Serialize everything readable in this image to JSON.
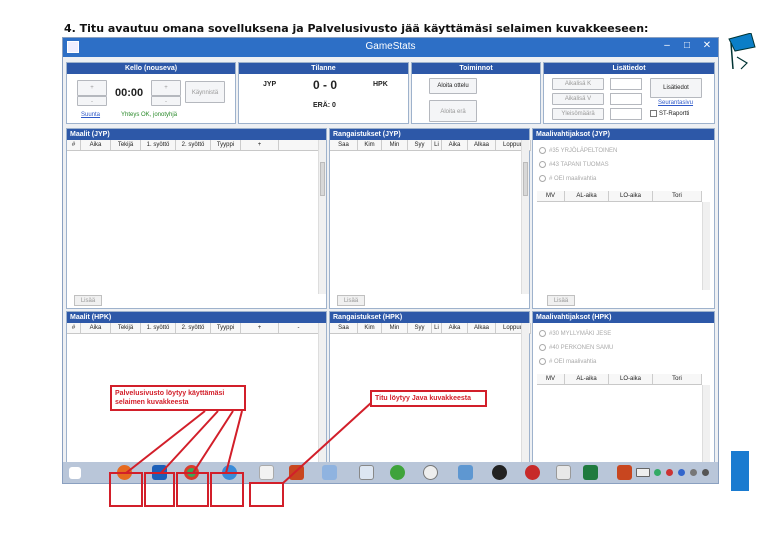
{
  "heading": "4. Titu avautuu omana sovelluksena ja Palvelusivusto jää käyttämäsi selaimen kuvakkeeseen:",
  "window": {
    "title": "GameStats",
    "controls": [
      "–",
      "□",
      "✕"
    ]
  },
  "clock_panel": {
    "header": "Kello (nouseva)",
    "plus": "+",
    "minus": "-",
    "time": "00:00",
    "start_button": "Käynnistä",
    "link": "Suunta",
    "status": "Yhteys OK, jonotyhjä"
  },
  "score_panel": {
    "header": "Tilanne",
    "home": "JYP",
    "away": "HPK",
    "score": "0 - 0",
    "period": "ERÄ: 0"
  },
  "actions_panel": {
    "header": "Toiminnot",
    "start_game": "Aloita ottelu",
    "start_period": "Aloita erä"
  },
  "extras_panel": {
    "header": "Lisätiedot",
    "labels": [
      "Aikalisä K",
      "Aikalisä V",
      "Yleisömäärä"
    ],
    "add_button": "Lisätiedot",
    "link": "Seurantasivu",
    "checkbox": "ST-Raportti"
  },
  "goals_jyp": {
    "header": "Maalit (JYP)",
    "columns": [
      "#",
      "Aika",
      "Tekijä",
      "1. syöttö",
      "2. syöttö",
      "Tyyppi",
      "+"
    ],
    "add": "Lisää"
  },
  "penalties_jyp": {
    "header": "Rangaistukset (JYP)",
    "columns": [
      "Saa",
      "Kim",
      "Min",
      "Syy",
      "Li",
      "Aika",
      "Alkaa",
      "Loppuu"
    ],
    "add": "Lisää"
  },
  "goalies_jyp": {
    "header": "Maalivahtijaksot (JYP)",
    "options": [
      "#35 YRJÖLÄPELTOINEN",
      "#43 TAPANI TUOMAS",
      "# OEI maalivahtia"
    ],
    "columns": [
      "MV",
      "AL-aika",
      "LO-aika",
      "Tori"
    ],
    "add": "Lisää"
  },
  "goals_hpk": {
    "header": "Maalit (HPK)",
    "columns": [
      "#",
      "Aika",
      "Tekijä",
      "1. syöttö",
      "2. syöttö",
      "Tyyppi",
      "+",
      "-"
    ],
    "add": "Lisää"
  },
  "penalties_hpk": {
    "header": "Rangaistukset (HPK)",
    "columns": [
      "Saa",
      "Kim",
      "Min",
      "Syy",
      "Li",
      "Aika",
      "Alkaa",
      "Loppuu"
    ]
  },
  "goalies_hpk": {
    "header": "Maalivahtijaksot (HPK)",
    "options": [
      "#30 MYLLYMÄKI JESE",
      "#40 PERKONEN SAMU",
      "# OEI maalivahtia"
    ],
    "columns": [
      "MV",
      "AL-aika",
      "LO-aika",
      "Tori"
    ]
  },
  "annotations": {
    "browser_note": "Palvelusivusto löytyy käyttämäsi selaimen kuvakkeesta",
    "java_note": "Titu löytyy Java kuvakkeesta"
  },
  "colors": {
    "accent": "#2d58a8",
    "annotation": "#d21f2a",
    "taskbar": "#b9c6d9"
  }
}
